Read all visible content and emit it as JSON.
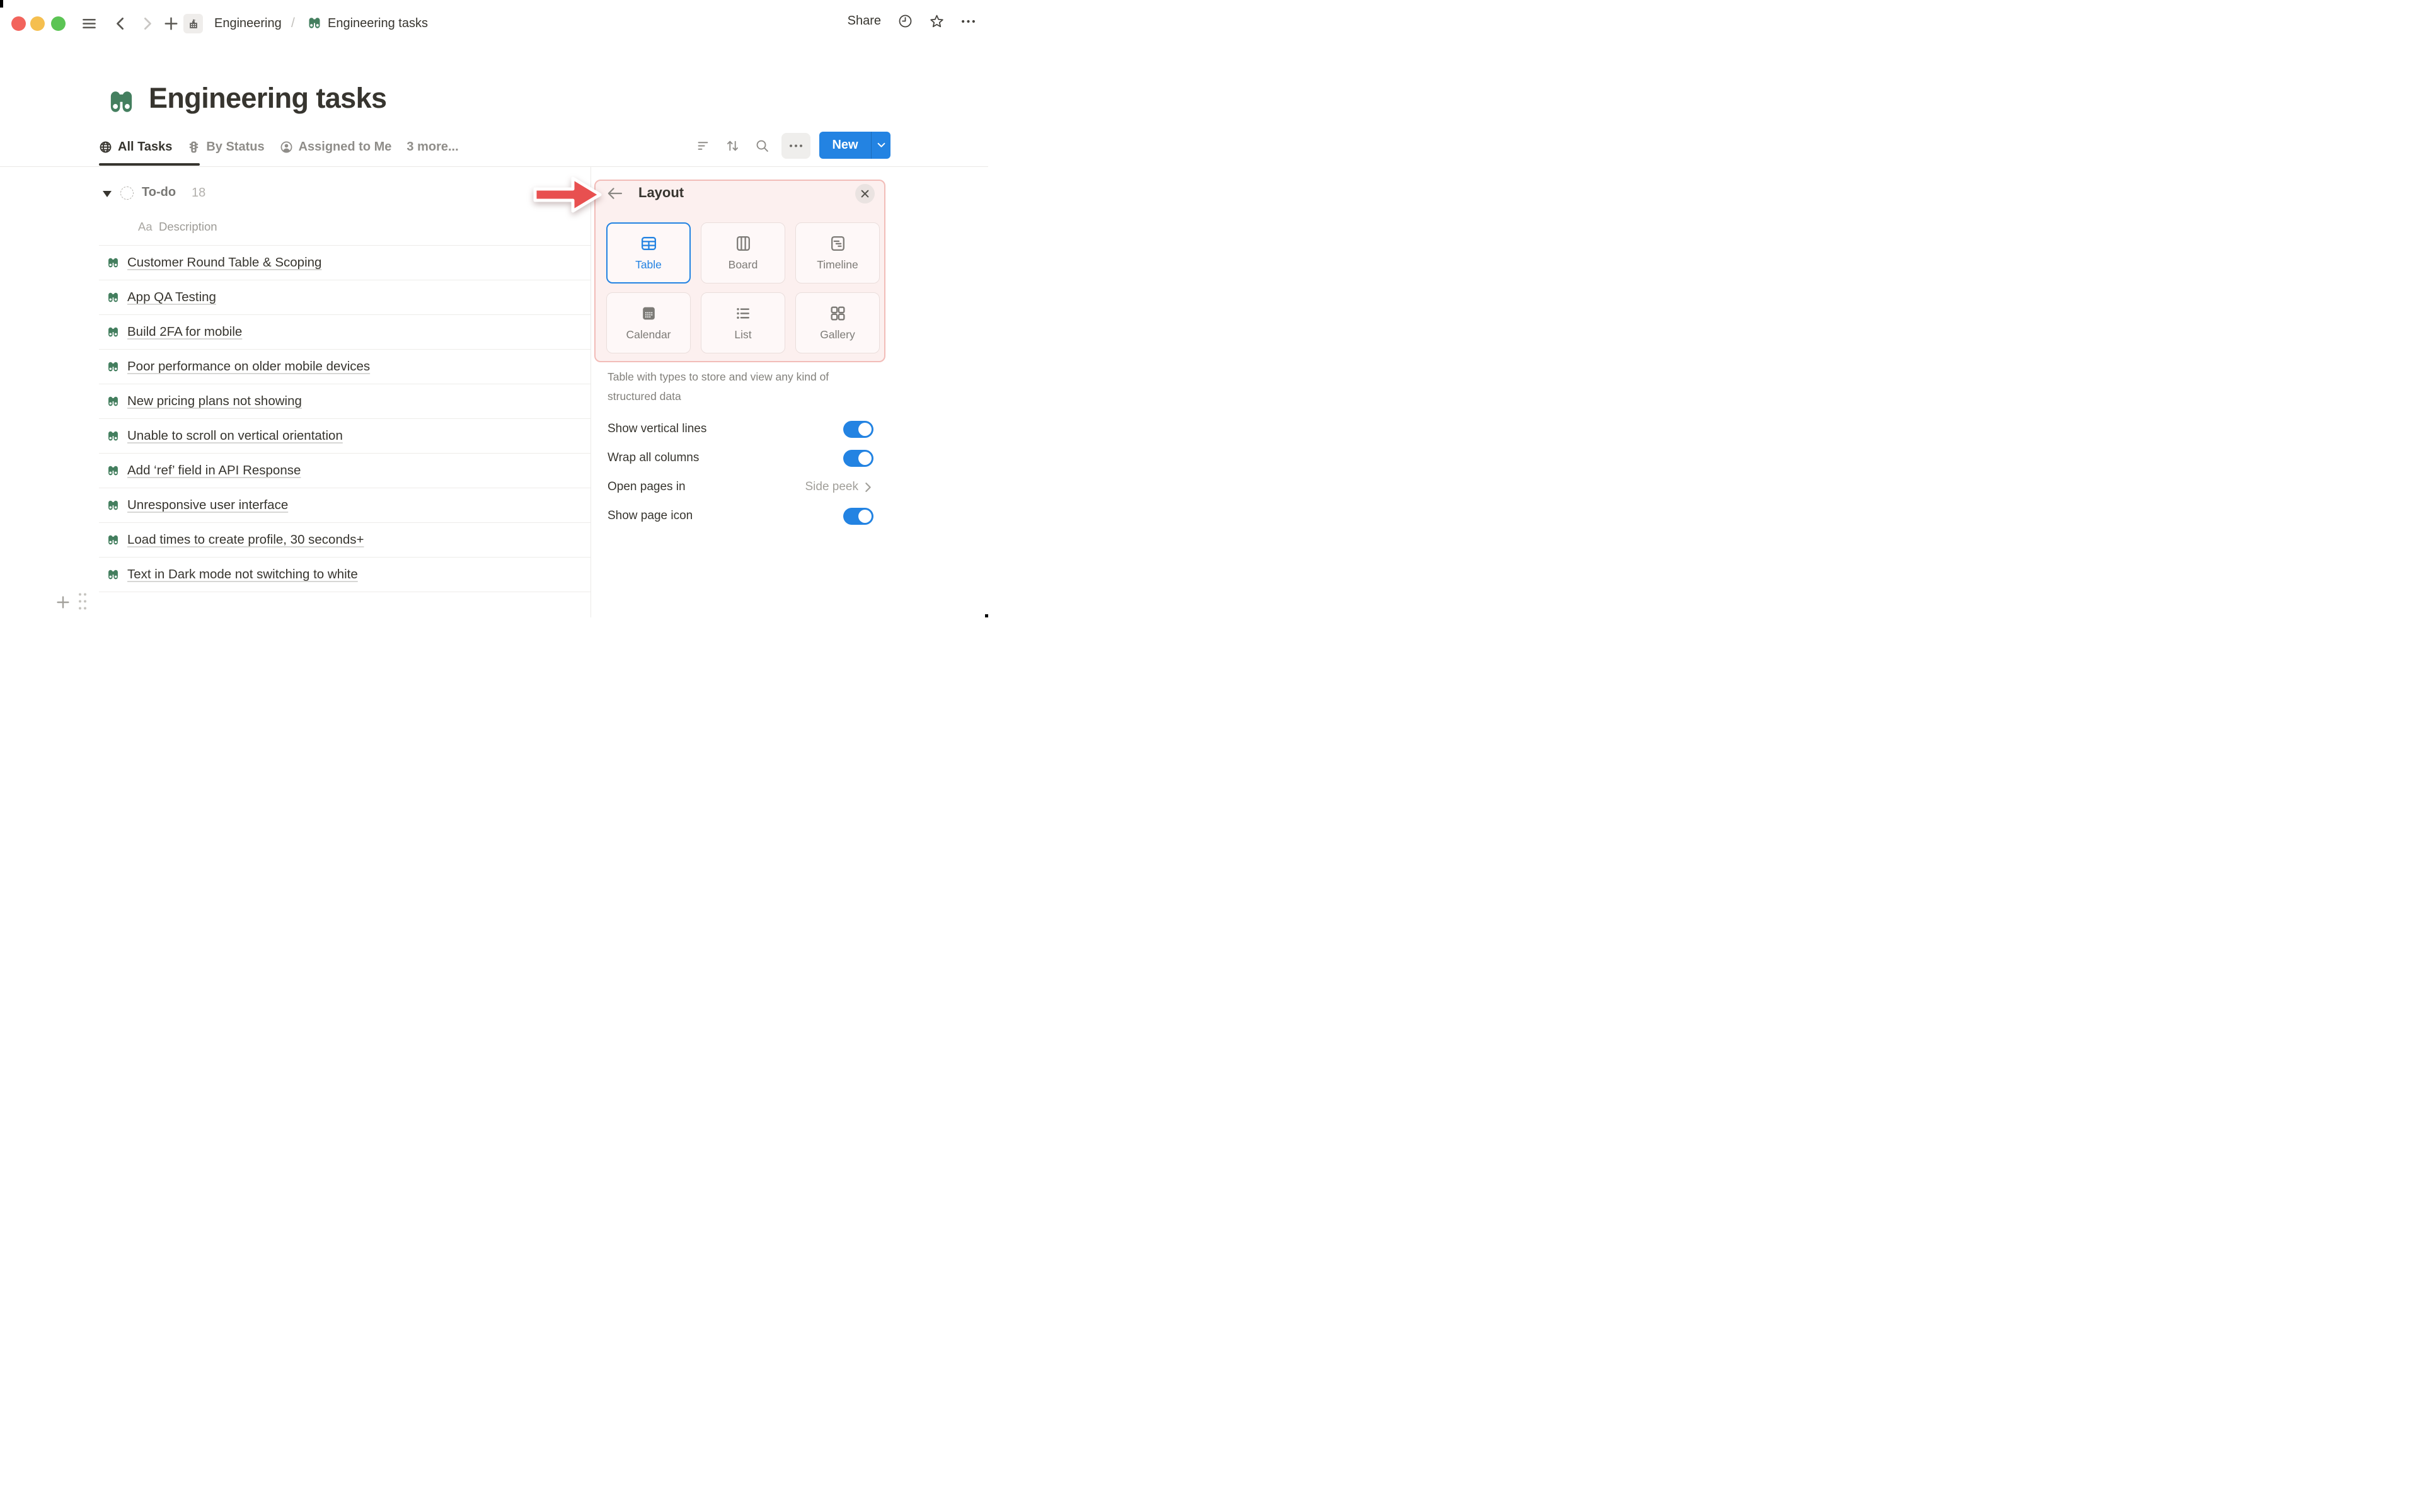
{
  "breadcrumb": {
    "workspace": "Engineering",
    "separator": "/",
    "page": "Engineering tasks"
  },
  "topbar": {
    "share_label": "Share"
  },
  "page": {
    "title": "Engineering tasks"
  },
  "view_tabs": [
    {
      "label": "All Tasks",
      "icon": "globe",
      "active": true
    },
    {
      "label": "By Status",
      "icon": "status",
      "active": false
    },
    {
      "label": "Assigned to Me",
      "icon": "person",
      "active": false
    },
    {
      "label": "3 more...",
      "icon": "",
      "active": false
    }
  ],
  "toolbar": {
    "new_label": "New"
  },
  "table": {
    "group": {
      "name": "To-do",
      "count": "18"
    },
    "column_header": {
      "type_label": "Aa",
      "name": "Description"
    },
    "rows": [
      {
        "title": "Customer Round Table & Scoping"
      },
      {
        "title": "App QA Testing"
      },
      {
        "title": "Build 2FA for mobile"
      },
      {
        "title": "Poor performance on older mobile devices"
      },
      {
        "title": "New pricing plans not showing"
      },
      {
        "title": "Unable to scroll on vertical orientation"
      },
      {
        "title": "Add ‘ref’ field in API Response"
      },
      {
        "title": "Unresponsive user interface"
      },
      {
        "title": "Load times to create profile, 30 seconds+"
      },
      {
        "title": "Text in Dark mode not switching to white"
      }
    ]
  },
  "panel": {
    "title": "Layout",
    "layouts": [
      {
        "label": "Table",
        "icon": "table",
        "selected": true
      },
      {
        "label": "Board",
        "icon": "board",
        "selected": false
      },
      {
        "label": "Timeline",
        "icon": "timeline",
        "selected": false
      },
      {
        "label": "Calendar",
        "icon": "calendar",
        "selected": false
      },
      {
        "label": "List",
        "icon": "list",
        "selected": false
      },
      {
        "label": "Gallery",
        "icon": "gallery",
        "selected": false
      }
    ],
    "description": "Table with types to store and view any kind of structured data",
    "settings": [
      {
        "label": "Show vertical lines",
        "type": "toggle",
        "value": true
      },
      {
        "label": "Wrap all columns",
        "type": "toggle",
        "value": true
      },
      {
        "label": "Open pages in",
        "type": "nav",
        "value": "Side peek"
      },
      {
        "label": "Show page icon",
        "type": "toggle",
        "value": true
      }
    ]
  },
  "colors": {
    "accent_blue": "#2383e2",
    "page_icon_green": "#447f5f",
    "annotation_red": "#e85050",
    "highlight_bg": "#fcf0ef",
    "highlight_border": "#f2bcb8",
    "traffic_red": "#f2645c",
    "traffic_yellow": "#f5bf4f",
    "traffic_green": "#5bc454"
  }
}
